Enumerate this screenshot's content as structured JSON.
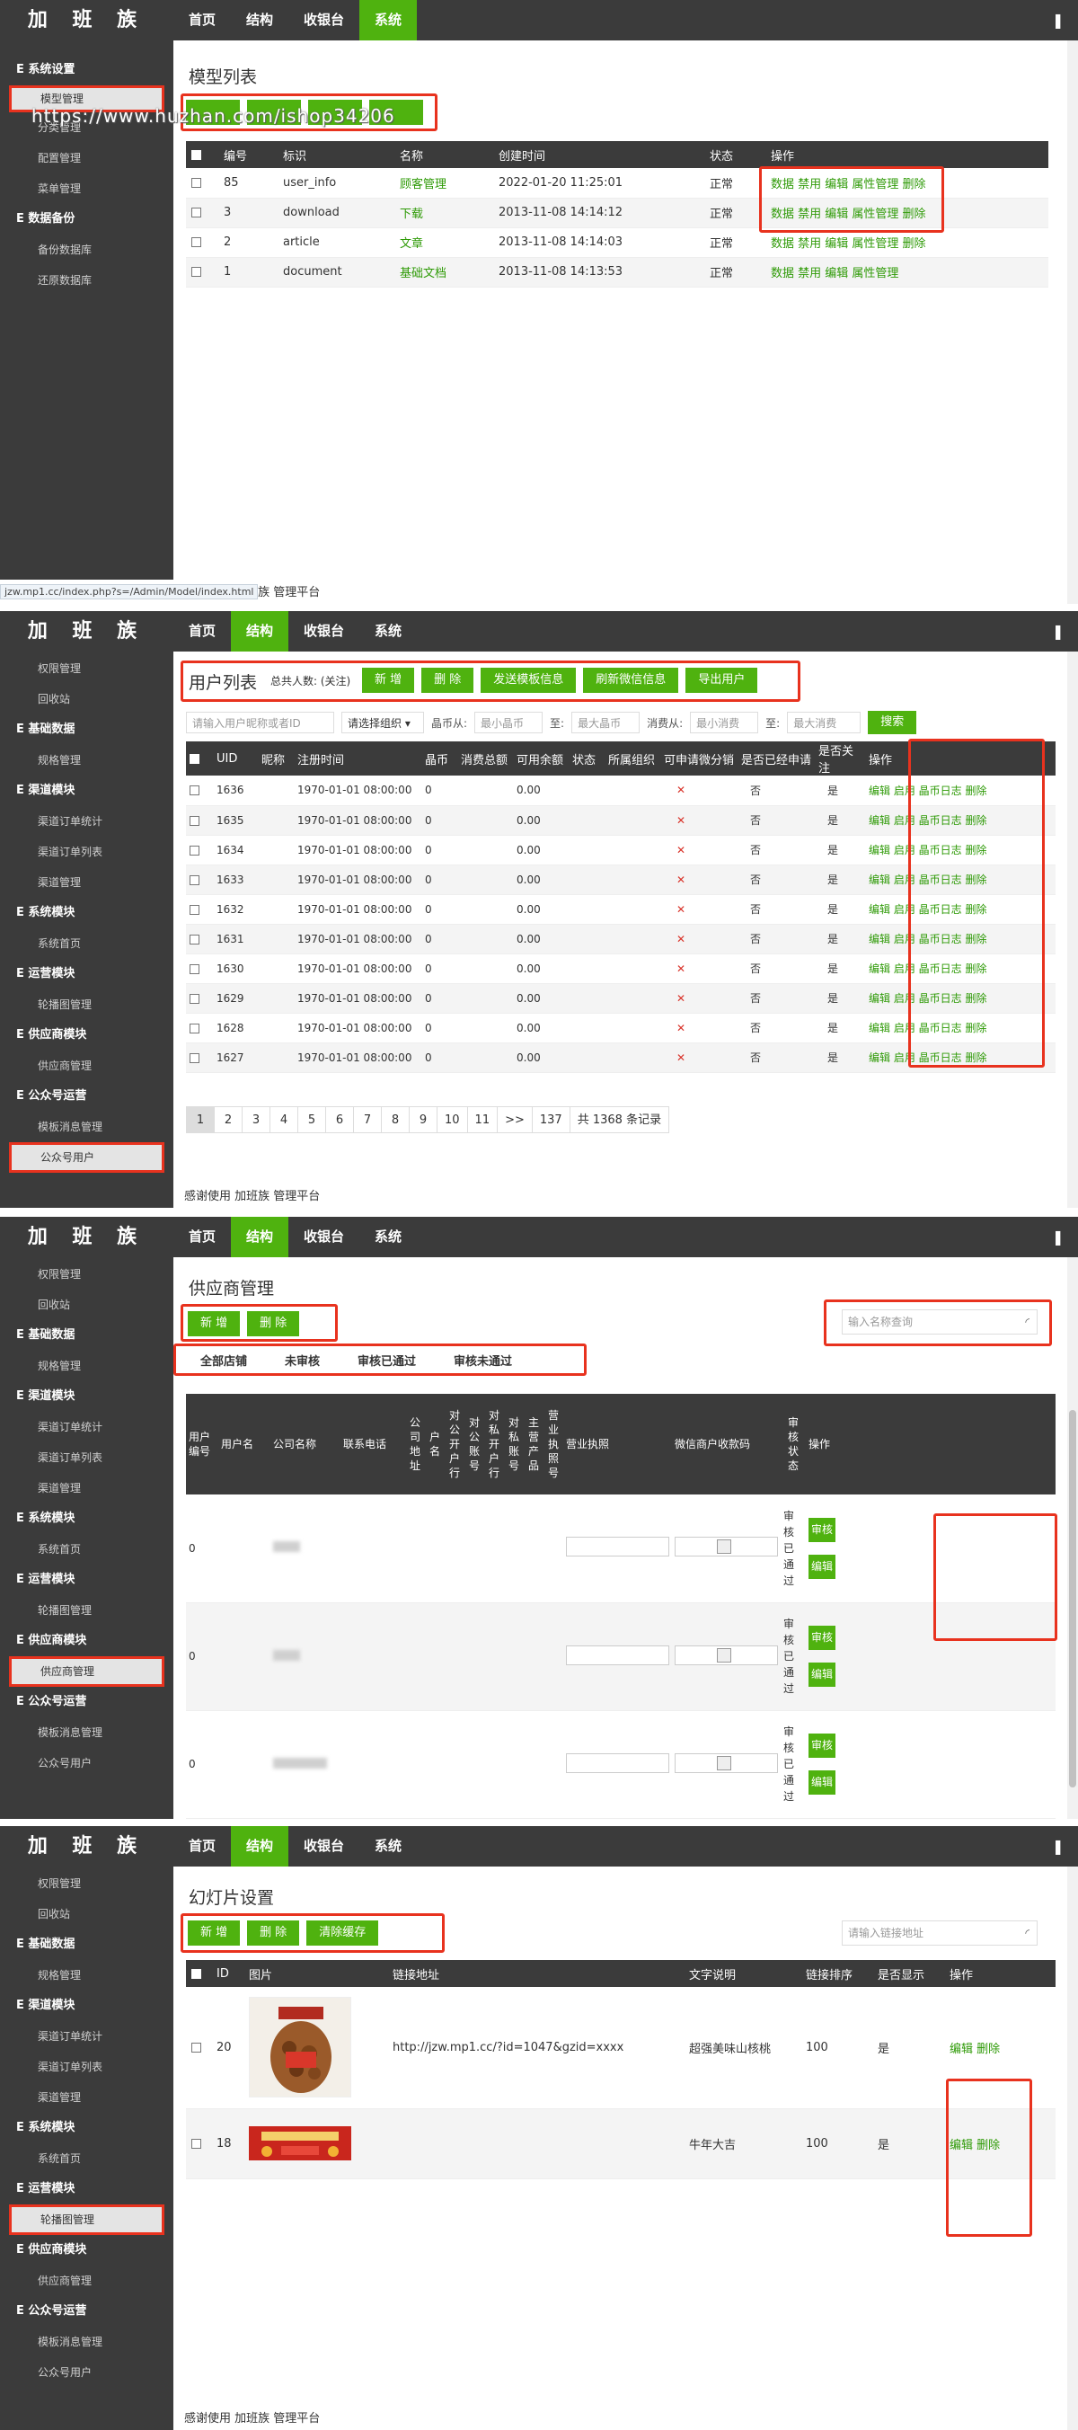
{
  "brand": "加 班 族",
  "nav": [
    "首页",
    "结构",
    "收银台",
    "系统"
  ],
  "panel1": {
    "sidebar": [
      {
        "type": "group",
        "label": "系统设置"
      },
      {
        "type": "item",
        "label": "模型管理",
        "active": true
      },
      {
        "type": "item",
        "label": "分类管理"
      },
      {
        "type": "item",
        "label": "配置管理"
      },
      {
        "type": "item",
        "label": "菜单管理"
      },
      {
        "type": "group",
        "label": "数据备份"
      },
      {
        "type": "item",
        "label": "备份数据库"
      },
      {
        "type": "item",
        "label": "还原数据库"
      }
    ],
    "title": "模型列表",
    "watermark": "https://www.huzhan.com/ishop34206",
    "columns": [
      "编号",
      "标识",
      "名称",
      "创建时间",
      "状态",
      "操作"
    ],
    "rows": [
      {
        "id": "85",
        "key": "user_info",
        "name": "顾客管理",
        "time": "2022-01-20 11:25:01",
        "status": "正常",
        "ops": "数据 禁用 编辑 属性管理 删除"
      },
      {
        "id": "3",
        "key": "download",
        "name": "下载",
        "time": "2013-11-08 14:14:12",
        "status": "正常",
        "ops": "数据 禁用 编辑 属性管理 删除"
      },
      {
        "id": "2",
        "key": "article",
        "name": "文章",
        "time": "2013-11-08 14:14:03",
        "status": "正常",
        "ops": "数据 禁用 编辑 属性管理 删除"
      },
      {
        "id": "1",
        "key": "document",
        "name": "基础文档",
        "time": "2013-11-08 14:13:53",
        "status": "正常",
        "ops": "数据 禁用 编辑 属性管理"
      }
    ],
    "footer": "感谢使用 加班族 管理平台",
    "statusbar": "jzw.mp1.cc/index.php?s=/Admin/Model/index.html"
  },
  "panel2": {
    "sidebar": [
      {
        "type": "item",
        "label": "权限管理"
      },
      {
        "type": "item",
        "label": "回收站"
      },
      {
        "type": "group",
        "label": "基础数据"
      },
      {
        "type": "item",
        "label": "规格管理"
      },
      {
        "type": "group",
        "label": "渠道模块"
      },
      {
        "type": "item",
        "label": "渠道订单统计"
      },
      {
        "type": "item",
        "label": "渠道订单列表"
      },
      {
        "type": "item",
        "label": "渠道管理"
      },
      {
        "type": "group",
        "label": "系统模块"
      },
      {
        "type": "item",
        "label": "系统首页"
      },
      {
        "type": "group",
        "label": "运营模块"
      },
      {
        "type": "item",
        "label": "轮播图管理"
      },
      {
        "type": "group",
        "label": "供应商模块"
      },
      {
        "type": "item",
        "label": "供应商管理"
      },
      {
        "type": "group",
        "label": "公众号运营"
      },
      {
        "type": "item",
        "label": "模板消息管理"
      },
      {
        "type": "item",
        "label": "公众号用户",
        "active": true
      }
    ],
    "title": "用户列表",
    "total_label": "总共人数: (关注)",
    "buttons": [
      "新 增",
      "删 除",
      "发送模板信息",
      "刷新微信信息",
      "导出用户"
    ],
    "filters": {
      "search_placeholder": "请输入用户昵称或者ID",
      "select": "请选择组织",
      "coin_from": "晶币从:",
      "coin_min": "最小晶币",
      "to1": "至:",
      "coin_max": "最大晶币",
      "spend_from": "消费从:",
      "spend_min": "最小消费",
      "to2": "至:",
      "spend_max": "最大消费",
      "search_btn": "搜索"
    },
    "columns": [
      "UID",
      "昵称",
      "注册时间",
      "晶币",
      "消费总额",
      "可用余额",
      "状态",
      "所属组织",
      "可申请微分销",
      "是否已经申请",
      "是否关注",
      "操作"
    ],
    "rows": [
      {
        "uid": "1636",
        "time": "1970-01-01 08:00:00",
        "coin": "0",
        "bal": "0.00",
        "applied": "否",
        "follow": "是"
      },
      {
        "uid": "1635",
        "time": "1970-01-01 08:00:00",
        "coin": "0",
        "bal": "0.00",
        "applied": "否",
        "follow": "是"
      },
      {
        "uid": "1634",
        "time": "1970-01-01 08:00:00",
        "coin": "0",
        "bal": "0.00",
        "applied": "否",
        "follow": "是"
      },
      {
        "uid": "1633",
        "time": "1970-01-01 08:00:00",
        "coin": "0",
        "bal": "0.00",
        "applied": "否",
        "follow": "是"
      },
      {
        "uid": "1632",
        "time": "1970-01-01 08:00:00",
        "coin": "0",
        "bal": "0.00",
        "applied": "否",
        "follow": "是"
      },
      {
        "uid": "1631",
        "time": "1970-01-01 08:00:00",
        "coin": "0",
        "bal": "0.00",
        "applied": "否",
        "follow": "是"
      },
      {
        "uid": "1630",
        "time": "1970-01-01 08:00:00",
        "coin": "0",
        "bal": "0.00",
        "applied": "否",
        "follow": "是"
      },
      {
        "uid": "1629",
        "time": "1970-01-01 08:00:00",
        "coin": "0",
        "bal": "0.00",
        "applied": "否",
        "follow": "是"
      },
      {
        "uid": "1628",
        "time": "1970-01-01 08:00:00",
        "coin": "0",
        "bal": "0.00",
        "applied": "否",
        "follow": "是"
      },
      {
        "uid": "1627",
        "time": "1970-01-01 08:00:00",
        "coin": "0",
        "bal": "0.00",
        "applied": "否",
        "follow": "是"
      }
    ],
    "row_ops": "编辑 启用 晶币日志 删除",
    "x_mark": "✕",
    "pager": [
      "1",
      "2",
      "3",
      "4",
      "5",
      "6",
      "7",
      "8",
      "9",
      "10",
      "11",
      ">>",
      "137",
      "共 1368 条记录"
    ],
    "footer": "感谢使用 加班族 管理平台"
  },
  "panel3": {
    "title": "供应商管理",
    "buttons": [
      "新 增",
      "删 除"
    ],
    "tabs": [
      "全部店铺",
      "未审核",
      "审核已通过",
      "审核未通过"
    ],
    "search_placeholder": "输入名称查询",
    "columns": [
      "用户编号",
      "用户名",
      "公司名称",
      "联系电话",
      "公司地址",
      "户名",
      "对公开户行",
      "对公账号",
      "对私开户行",
      "对私账号",
      "主营产品",
      "营业执照号",
      "营业执照",
      "微信商户收款码",
      "审核状态",
      "操作"
    ],
    "rows": [
      {
        "uid": "0",
        "status": "审核已通过"
      },
      {
        "uid": "0",
        "status": "审核已通过"
      },
      {
        "uid": "0",
        "status": "审核已通过"
      }
    ],
    "btn_review": "审核",
    "btn_edit": "编辑"
  },
  "panel4": {
    "title": "幻灯片设置",
    "buttons": [
      "新 增",
      "删 除",
      "清除缓存"
    ],
    "search_placeholder": "请输入链接地址",
    "columns": [
      "ID",
      "图片",
      "链接地址",
      "文字说明",
      "链接排序",
      "是否显示",
      "操作"
    ],
    "rows": [
      {
        "id": "20",
        "url": "http://jzw.mp1.cc/?id=1047&gzid=xxxx",
        "desc": "超强美味山核桃",
        "sort": "100",
        "show": "是",
        "ops": "编辑 删除"
      },
      {
        "id": "18",
        "url": "",
        "desc": "牛年大吉",
        "sort": "100",
        "show": "是",
        "ops": "编辑 删除"
      }
    ],
    "footer": "感谢使用 加班族 管理平台"
  },
  "sidebar_common": [
    {
      "type": "item",
      "label": "权限管理"
    },
    {
      "type": "item",
      "label": "回收站"
    },
    {
      "type": "group",
      "label": "基础数据"
    },
    {
      "type": "item",
      "label": "规格管理"
    },
    {
      "type": "group",
      "label": "渠道模块"
    },
    {
      "type": "item",
      "label": "渠道订单统计"
    },
    {
      "type": "item",
      "label": "渠道订单列表"
    },
    {
      "type": "item",
      "label": "渠道管理"
    },
    {
      "type": "group",
      "label": "系统模块"
    },
    {
      "type": "item",
      "label": "系统首页"
    },
    {
      "type": "group",
      "label": "运营模块"
    },
    {
      "type": "item",
      "label": "轮播图管理"
    },
    {
      "type": "group",
      "label": "供应商模块"
    },
    {
      "type": "item",
      "label": "供应商管理"
    },
    {
      "type": "group",
      "label": "公众号运营"
    },
    {
      "type": "item",
      "label": "模板消息管理"
    },
    {
      "type": "item",
      "label": "公众号用户"
    }
  ]
}
